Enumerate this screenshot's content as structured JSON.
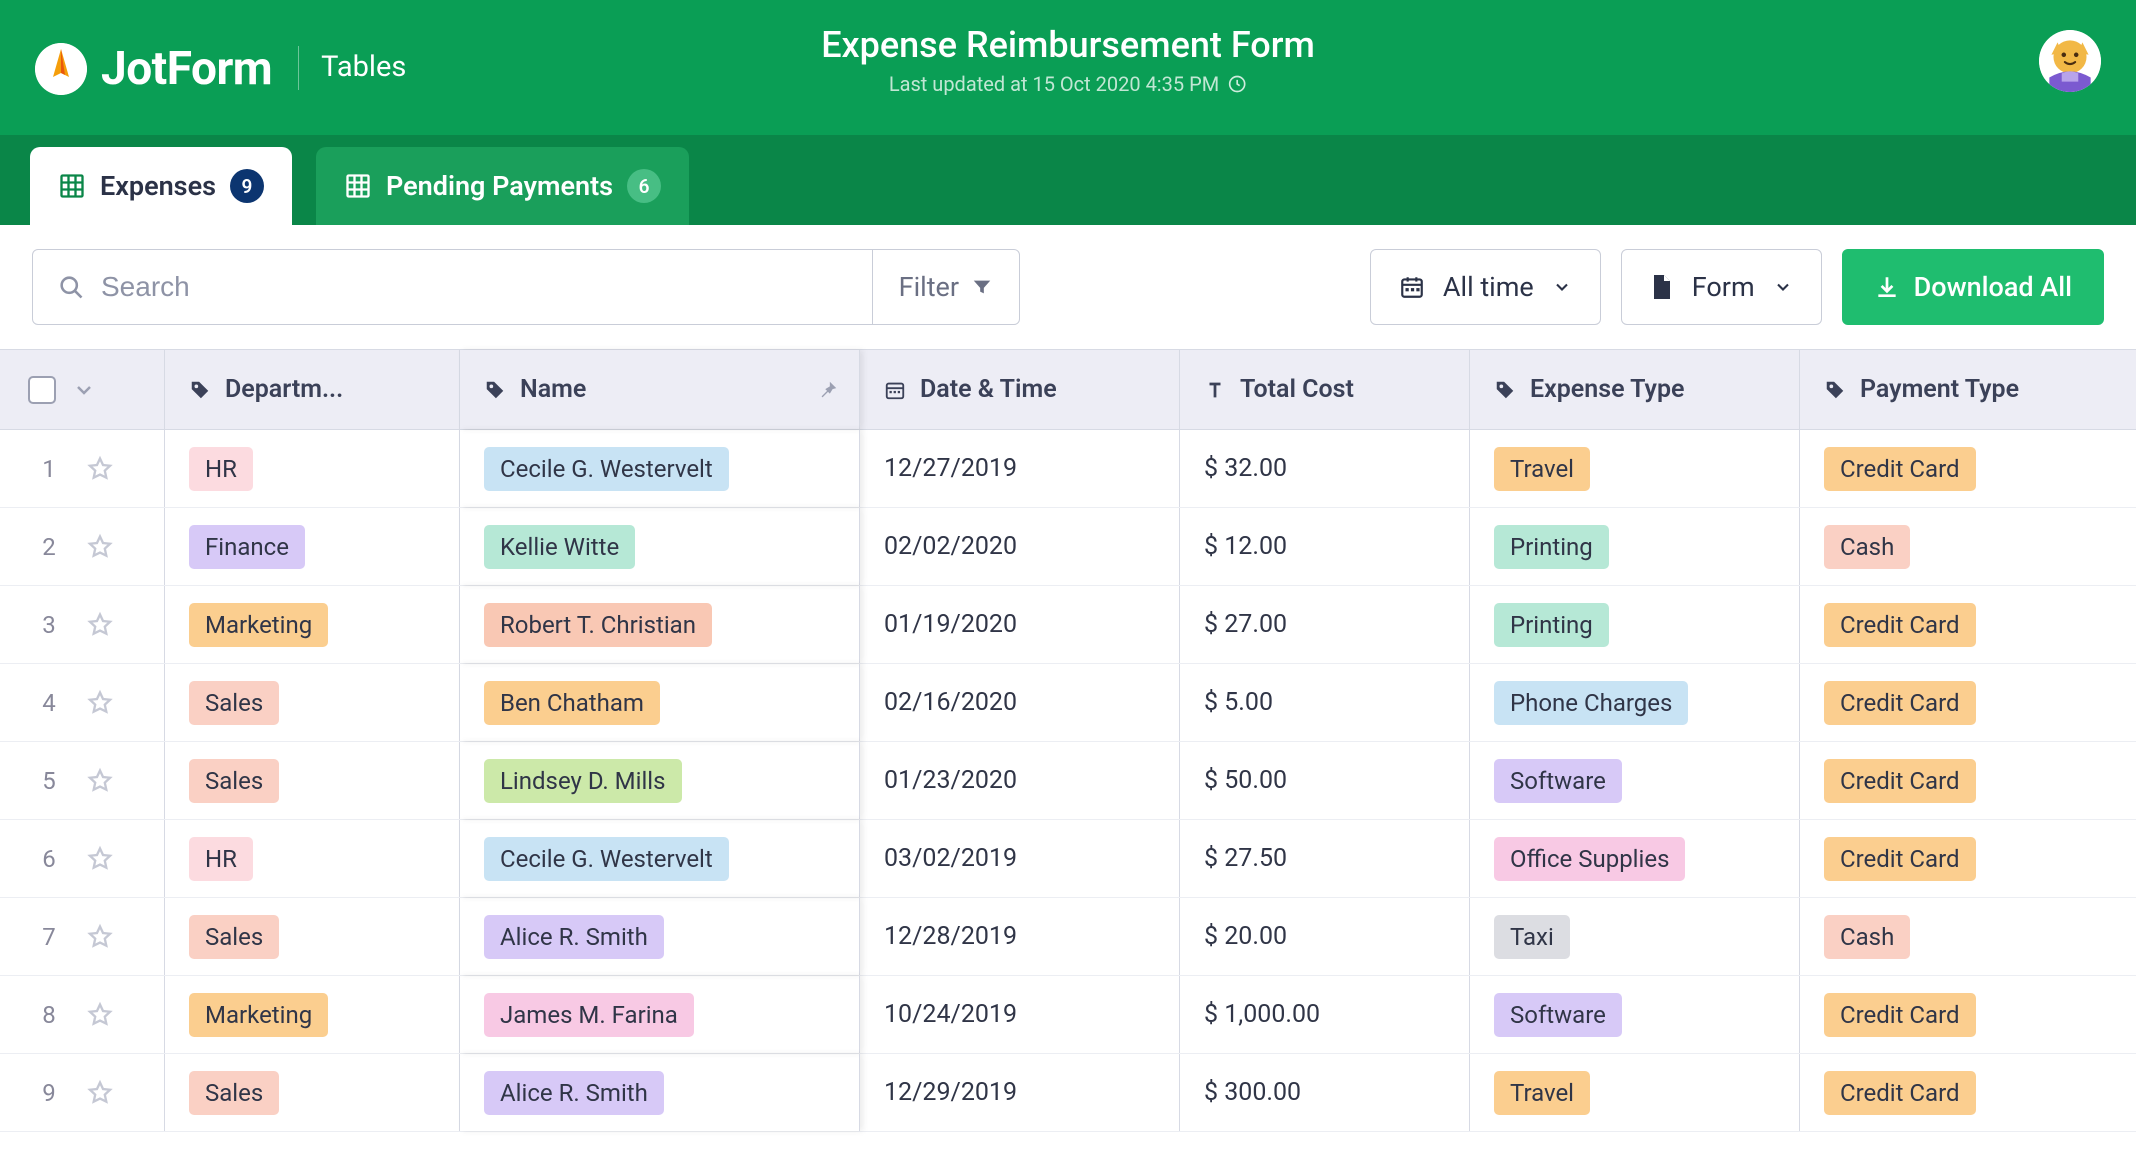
{
  "brand": {
    "name": "JotForm",
    "section": "Tables"
  },
  "page": {
    "title": "Expense Reimbursement Form",
    "subtitle": "Last updated at 15 Oct 2020 4:35 PM"
  },
  "tabs": [
    {
      "label": "Expenses",
      "count": "9",
      "active": true
    },
    {
      "label": "Pending Payments",
      "count": "6",
      "active": false
    }
  ],
  "toolbar": {
    "search_placeholder": "Search",
    "filter_label": "Filter",
    "time_label": "All time",
    "form_label": "Form",
    "download_label": "Download All"
  },
  "columns": {
    "dept": "Departm...",
    "name": "Name",
    "date": "Date & Time",
    "cost": "Total Cost",
    "exp": "Expense Type",
    "pay": "Payment Type"
  },
  "rows": [
    {
      "n": "1",
      "dept": "HR",
      "dept_c": "c-hr",
      "name": "Cecile G. Westervelt",
      "name_c": "c-name-blue",
      "date": "12/27/2019",
      "cost": "$ 32.00",
      "exp": "Travel",
      "exp_c": "c-travel",
      "pay": "Credit Card",
      "pay_c": "c-credit"
    },
    {
      "n": "2",
      "dept": "Finance",
      "dept_c": "c-finance",
      "name": "Kellie Witte",
      "name_c": "c-name-teal",
      "date": "02/02/2020",
      "cost": "$ 12.00",
      "exp": "Printing",
      "exp_c": "c-printing",
      "pay": "Cash",
      "pay_c": "c-cash"
    },
    {
      "n": "3",
      "dept": "Marketing",
      "dept_c": "c-marketing",
      "name": "Robert T. Christian",
      "name_c": "c-name-peach",
      "date": "01/19/2020",
      "cost": "$ 27.00",
      "exp": "Printing",
      "exp_c": "c-printing",
      "pay": "Credit Card",
      "pay_c": "c-credit"
    },
    {
      "n": "4",
      "dept": "Sales",
      "dept_c": "c-sales",
      "name": "Ben Chatham",
      "name_c": "c-name-orange",
      "date": "02/16/2020",
      "cost": "$ 5.00",
      "exp": "Phone Charges",
      "exp_c": "c-phone",
      "pay": "Credit Card",
      "pay_c": "c-credit"
    },
    {
      "n": "5",
      "dept": "Sales",
      "dept_c": "c-sales",
      "name": "Lindsey D. Mills",
      "name_c": "c-name-green",
      "date": "01/23/2020",
      "cost": "$ 50.00",
      "exp": "Software",
      "exp_c": "c-software",
      "pay": "Credit Card",
      "pay_c": "c-credit"
    },
    {
      "n": "6",
      "dept": "HR",
      "dept_c": "c-hr",
      "name": "Cecile G. Westervelt",
      "name_c": "c-name-blue",
      "date": "03/02/2019",
      "cost": "$ 27.50",
      "exp": "Office Supplies",
      "exp_c": "c-office",
      "pay": "Credit Card",
      "pay_c": "c-credit"
    },
    {
      "n": "7",
      "dept": "Sales",
      "dept_c": "c-sales",
      "name": "Alice R. Smith",
      "name_c": "c-name-purple",
      "date": "12/28/2019",
      "cost": "$ 20.00",
      "exp": "Taxi",
      "exp_c": "c-taxi",
      "pay": "Cash",
      "pay_c": "c-cash"
    },
    {
      "n": "8",
      "dept": "Marketing",
      "dept_c": "c-marketing",
      "name": "James M. Farina",
      "name_c": "c-name-pink",
      "date": "10/24/2019",
      "cost": "$ 1,000.00",
      "exp": "Software",
      "exp_c": "c-software",
      "pay": "Credit Card",
      "pay_c": "c-credit"
    },
    {
      "n": "9",
      "dept": "Sales",
      "dept_c": "c-sales",
      "name": "Alice R. Smith",
      "name_c": "c-name-purple",
      "date": "12/29/2019",
      "cost": "$ 300.00",
      "exp": "Travel",
      "exp_c": "c-travel",
      "pay": "Credit Card",
      "pay_c": "c-credit"
    }
  ]
}
